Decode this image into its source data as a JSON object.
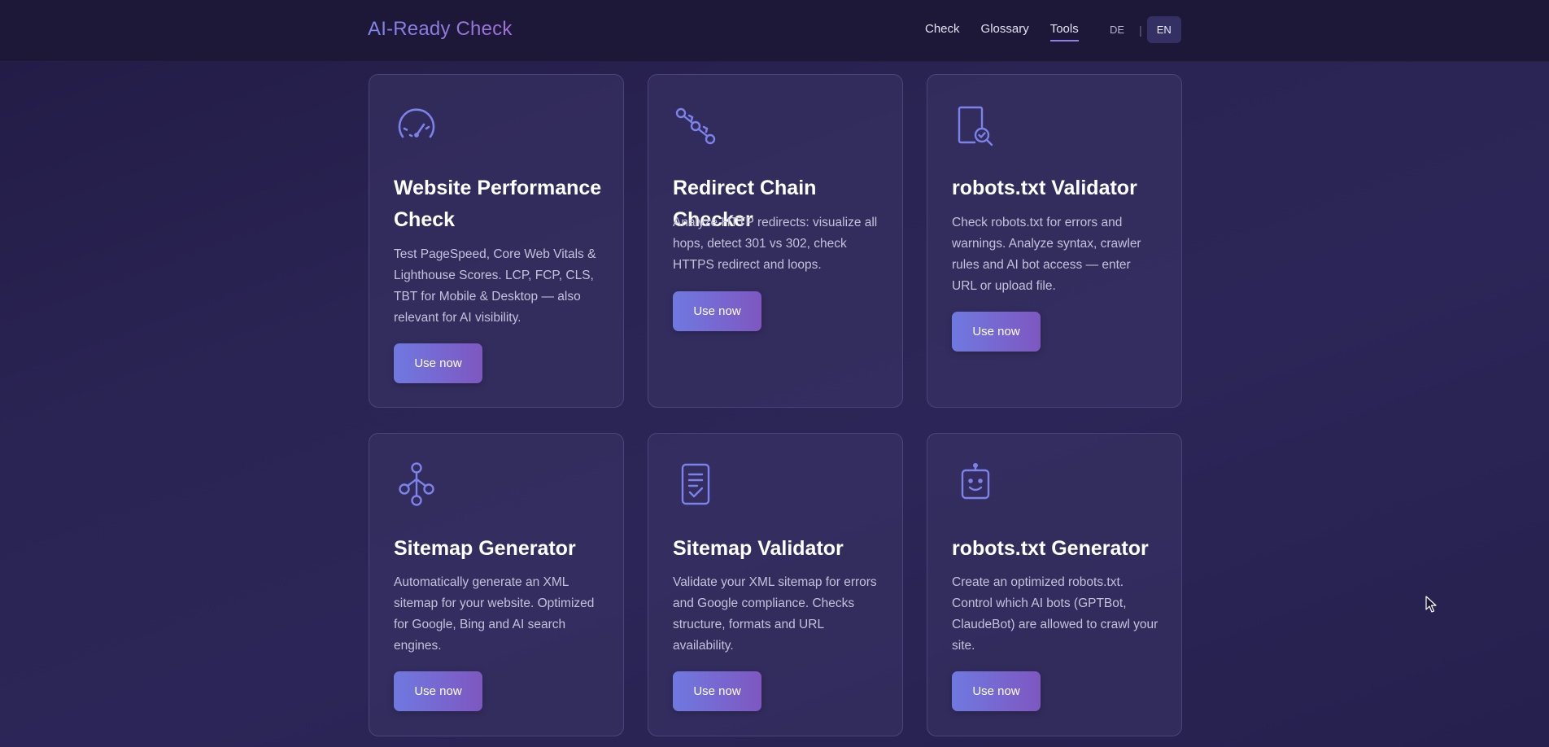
{
  "header": {
    "brand": "AI-Ready Check",
    "nav": [
      {
        "label": "Check"
      },
      {
        "label": "Glossary"
      },
      {
        "label": "Tools"
      }
    ],
    "lang": {
      "de": "DE",
      "separator": "|",
      "en": "EN"
    }
  },
  "cards": [
    {
      "icon": "speedometer-icon",
      "title": "Website Performance Check",
      "description": "Test PageSpeed, Core Web Vitals & Lighthouse Scores. LCP, FCP, CLS, TBT for Mobile & Desktop — also relevant for AI visibility.",
      "button": "Use now"
    },
    {
      "icon": "redirect-chain-icon",
      "title": "Redirect Chain Checker",
      "description": "Analyze HTTP redirects: visualize all hops, detect 301 vs 302, check HTTPS redirect and loops.",
      "button": "Use now"
    },
    {
      "icon": "file-search-icon",
      "title": "robots.txt Validator",
      "description": "Check robots.txt for errors and warnings. Analyze syntax, crawler rules and AI bot access — enter URL or upload file.",
      "button": "Use now"
    },
    {
      "icon": "sitemap-tree-icon",
      "title": "Sitemap Generator",
      "description": "Automatically generate an XML sitemap for your website. Optimized for Google, Bing and AI search engines.",
      "button": "Use now"
    },
    {
      "icon": "document-check-icon",
      "title": "Sitemap Validator",
      "description": "Validate your XML sitemap for errors and Google compliance. Checks structure, formats and URL availability.",
      "button": "Use now"
    },
    {
      "icon": "robot-icon",
      "title": "robots.txt Generator",
      "description": "Create an optimized robots.txt. Control which AI bots (GPTBot, ClaudeBot) are allowed to crawl your site.",
      "button": "Use now"
    }
  ],
  "colors": {
    "accent": "#7b7fe6",
    "icon": "#7b82ea",
    "background": "#28224f"
  }
}
